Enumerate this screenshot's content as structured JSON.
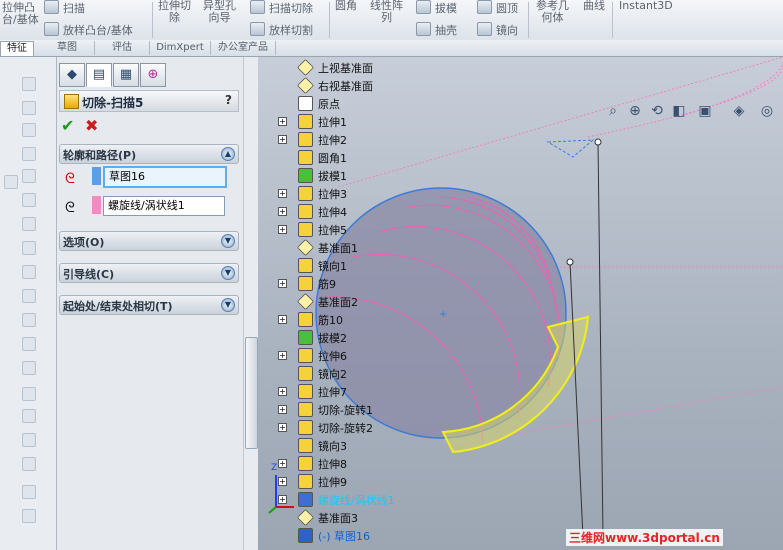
{
  "ribbon": {
    "items": [
      {
        "label": "拉伸凸",
        "x": 0
      },
      {
        "label": "台/基体",
        "x": 0
      }
    ],
    "left_big": [
      "拉伸凸",
      "台/基体"
    ],
    "sweep": "扫描",
    "loft": "放样凸台/基体",
    "cut_extrude": [
      "拉伸切",
      "除"
    ],
    "hole_wizard": [
      "异型孔",
      "向导"
    ],
    "sweep_cut": "扫描切除",
    "loft_cut": "放样切割",
    "fillet": "圆角",
    "linear_pattern": [
      "线性阵",
      "列"
    ],
    "draft": "拔模",
    "shell": "抽壳",
    "dome": "圆顶",
    "mirror": "镜向",
    "ref_geom": [
      "参考几",
      "何体"
    ],
    "curves": "曲线",
    "instant3d": "Instant3D"
  },
  "command_manager": {
    "tabs": [
      "特征",
      "草图",
      "评估",
      "DimXpert",
      "办公室产品"
    ]
  },
  "property_manager": {
    "title": "切除-扫描5",
    "help": "?",
    "ok": "✔",
    "cancel": "✖",
    "sections": {
      "profile_path": "轮廓和路径(P)",
      "options": "选项(O)",
      "guide": "引导线(C)",
      "tangency": "起始处/结束处相切(T)"
    },
    "profile_value": "草图16",
    "path_value": "螺旋线/涡状线1",
    "profile_color": "#5b9ee6",
    "path_color": "#f08cc0"
  },
  "tree": [
    {
      "label": "上视基准面",
      "plus": false,
      "icon": "plane"
    },
    {
      "label": "右视基准面",
      "plus": false,
      "icon": "plane"
    },
    {
      "label": "原点",
      "plus": false,
      "icon": "origin"
    },
    {
      "label": "拉伸1",
      "plus": true,
      "icon": "extrude"
    },
    {
      "label": "拉伸2",
      "plus": true,
      "icon": "extrude"
    },
    {
      "label": "圆角1",
      "plus": false,
      "icon": "fillet"
    },
    {
      "label": "拔模1",
      "plus": false,
      "icon": "draft"
    },
    {
      "label": "拉伸3",
      "plus": true,
      "icon": "extrude"
    },
    {
      "label": "拉伸4",
      "plus": true,
      "icon": "extrude"
    },
    {
      "label": "拉伸5",
      "plus": true,
      "icon": "extrude"
    },
    {
      "label": "基准面1",
      "plus": false,
      "icon": "plane"
    },
    {
      "label": "镜向1",
      "plus": false,
      "icon": "mirror"
    },
    {
      "label": "筋9",
      "plus": true,
      "icon": "rib"
    },
    {
      "label": "基准面2",
      "plus": false,
      "icon": "plane"
    },
    {
      "label": "筋10",
      "plus": true,
      "icon": "rib"
    },
    {
      "label": "拔模2",
      "plus": false,
      "icon": "draft"
    },
    {
      "label": "拉伸6",
      "plus": true,
      "icon": "extrude"
    },
    {
      "label": "镜向2",
      "plus": false,
      "icon": "mirror"
    },
    {
      "label": "拉伸7",
      "plus": true,
      "icon": "extrude"
    },
    {
      "label": "切除-旋转1",
      "plus": true,
      "icon": "revolve"
    },
    {
      "label": "切除-旋转2",
      "plus": true,
      "icon": "revolve"
    },
    {
      "label": "镜向3",
      "plus": false,
      "icon": "mirror"
    },
    {
      "label": "拉伸8",
      "plus": true,
      "icon": "extrude"
    },
    {
      "label": "拉伸9",
      "plus": true,
      "icon": "extrude"
    },
    {
      "label": "螺旋线/涡状线1",
      "plus": true,
      "icon": "helix",
      "style": "cyan"
    },
    {
      "label": "基准面3",
      "plus": false,
      "icon": "plane"
    },
    {
      "label": "(-) 草图16",
      "plus": false,
      "icon": "sketch",
      "style": "blue"
    }
  ],
  "watermark": "三维网www.3dportal.cn",
  "triad": {
    "z": "Z",
    "x": "X",
    "y": "Y"
  }
}
